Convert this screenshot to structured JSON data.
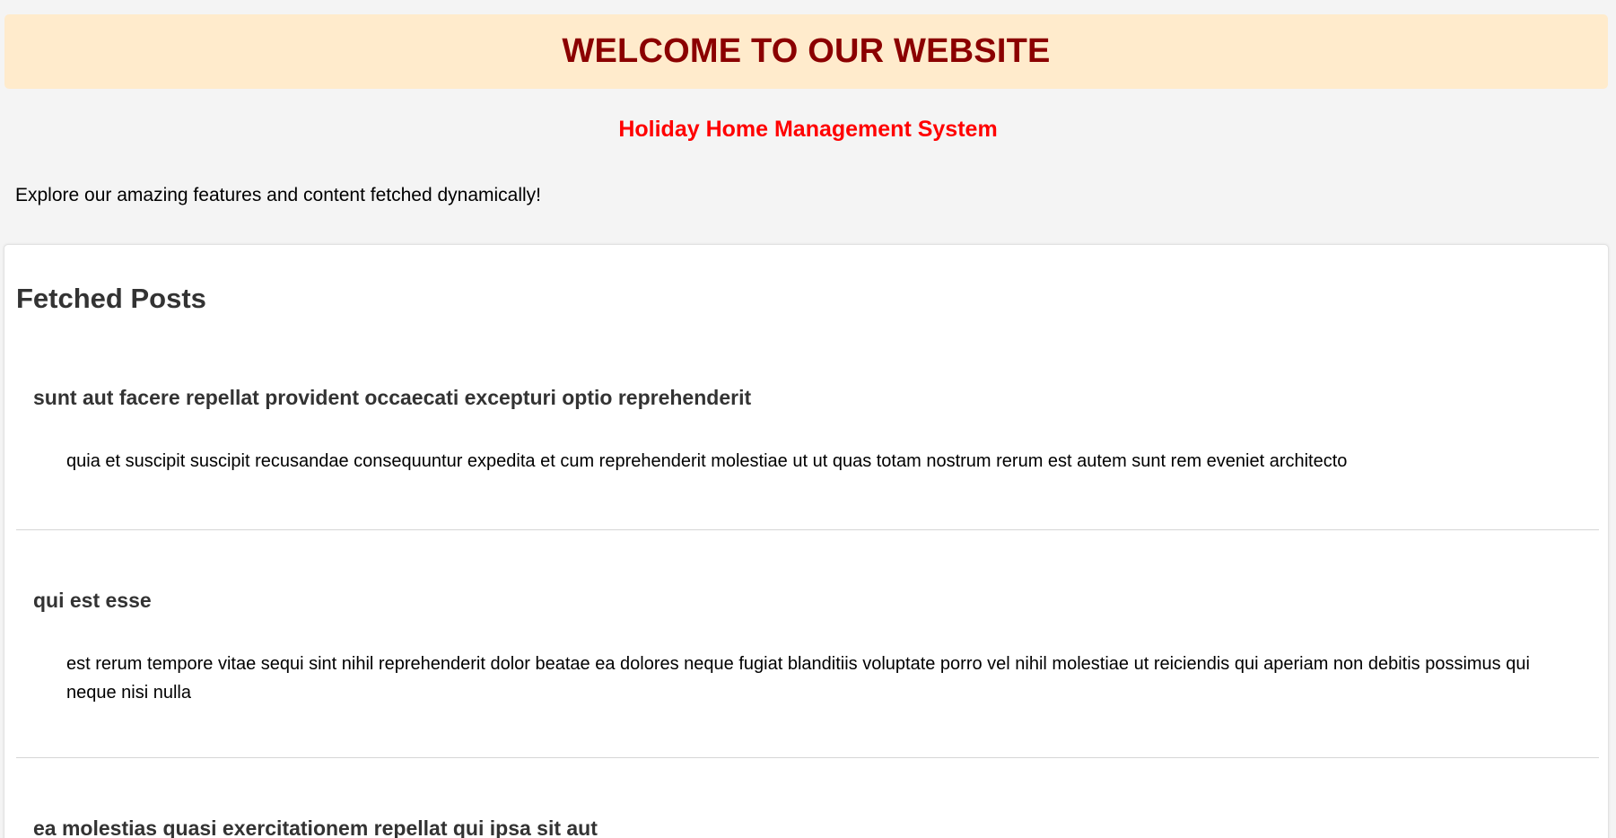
{
  "header": {
    "title": "WELCOME TO OUR WEBSITE",
    "subtitle": "Holiday Home Management System",
    "intro": "Explore our amazing features and content fetched dynamically!"
  },
  "colors": {
    "banner_bg": "#ffebcc",
    "title_color": "#8b0000",
    "subtitle_color": "#ff0000",
    "page_bg": "#f4f4f4"
  },
  "posts": {
    "heading": "Fetched Posts",
    "items": [
      {
        "title": "sunt aut facere repellat provident occaecati excepturi optio reprehenderit",
        "body": "quia et suscipit suscipit recusandae consequuntur expedita et cum reprehenderit molestiae ut ut quas totam nostrum rerum est autem sunt rem eveniet architecto"
      },
      {
        "title": "qui est esse",
        "body": "est rerum tempore vitae sequi sint nihil reprehenderit dolor beatae ea dolores neque fugiat blanditiis voluptate porro vel nihil molestiae ut reiciendis qui aperiam non debitis possimus qui neque nisi nulla"
      },
      {
        "title": "ea molestias quasi exercitationem repellat qui ipsa sit aut"
      }
    ]
  }
}
